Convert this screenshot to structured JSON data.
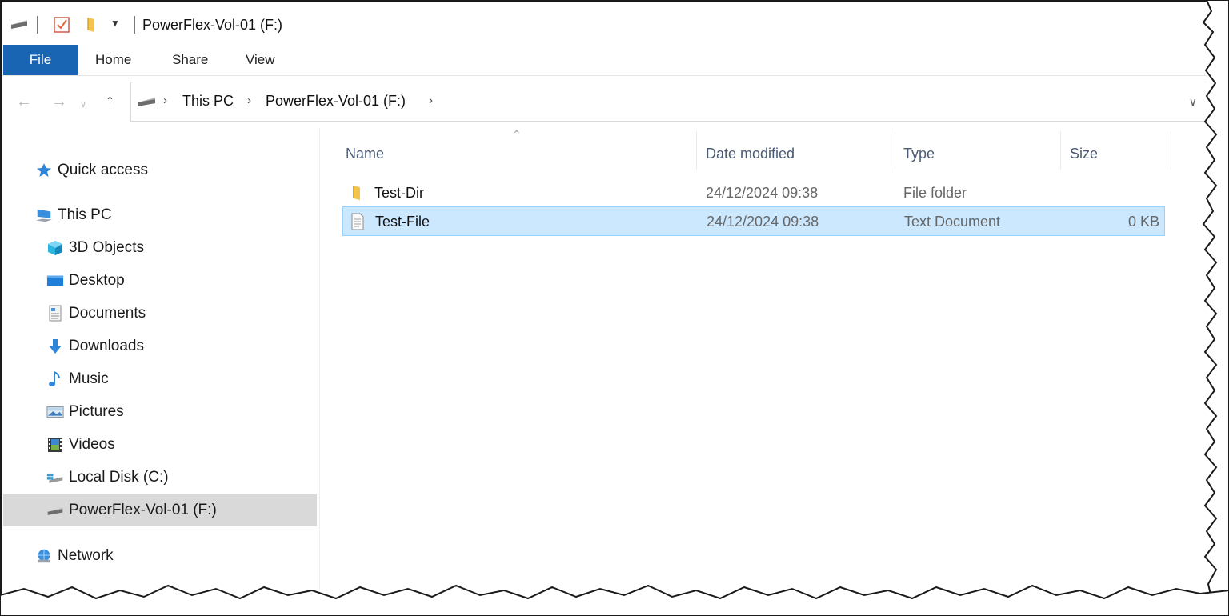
{
  "window": {
    "title": "PowerFlex-Vol-01 (F:)"
  },
  "ribbon": {
    "tabs": [
      "File",
      "Home",
      "Share",
      "View"
    ]
  },
  "address": {
    "crumbs": [
      "This PC",
      "PowerFlex-Vol-01 (F:)"
    ]
  },
  "sidebar": {
    "quick_access": "Quick access",
    "this_pc": "This PC",
    "items": [
      "3D Objects",
      "Desktop",
      "Documents",
      "Downloads",
      "Music",
      "Pictures",
      "Videos",
      "Local Disk (C:)",
      "PowerFlex-Vol-01 (F:)"
    ],
    "network": "Network",
    "selected": "PowerFlex-Vol-01 (F:)"
  },
  "columns": {
    "name": "Name",
    "date": "Date modified",
    "type": "Type",
    "size": "Size"
  },
  "files": [
    {
      "name": "Test-Dir",
      "date": "24/12/2024 09:38",
      "type": "File folder",
      "size": "",
      "icon": "folder-icon"
    },
    {
      "name": "Test-File",
      "date": "24/12/2024 09:38",
      "type": "Text Document",
      "size": "0 KB",
      "icon": "text-file-icon",
      "selected": true
    }
  ],
  "colors": {
    "accent": "#1a64b4",
    "selection": "#cce8ff",
    "selection_border": "#99d1ff",
    "sidebar_selected": "#d9d9d9"
  }
}
